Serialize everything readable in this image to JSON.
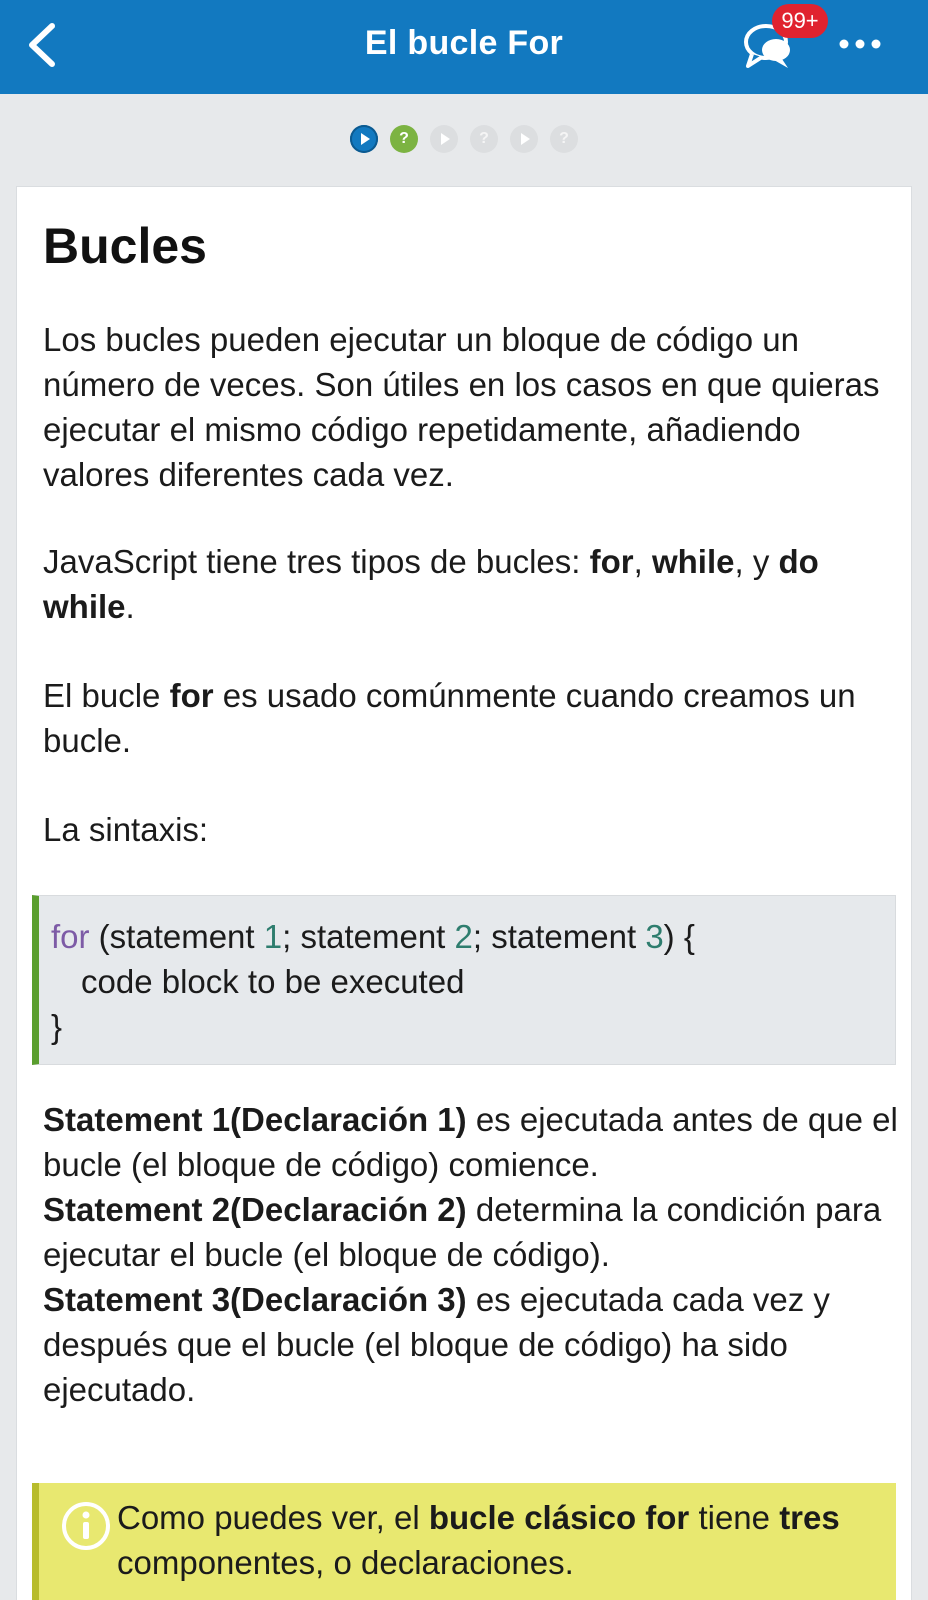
{
  "header": {
    "title": "El bucle For",
    "badge": "99+",
    "icons": {
      "back": "chevron-left-icon",
      "chat": "chat-bubbles-icon",
      "more": "more-dots-icon"
    },
    "background": "#1279c0"
  },
  "progress": {
    "steps": [
      {
        "type": "lesson",
        "state": "active",
        "glyph": ""
      },
      {
        "type": "quiz",
        "state": "done",
        "glyph": "?"
      },
      {
        "type": "lesson",
        "state": "pending",
        "glyph": ""
      },
      {
        "type": "quiz",
        "state": "pending",
        "glyph": "?"
      },
      {
        "type": "lesson",
        "state": "pending",
        "glyph": ""
      },
      {
        "type": "quiz",
        "state": "pending",
        "glyph": "?"
      }
    ]
  },
  "content": {
    "heading": "Bucles",
    "p1": "Los bucles pueden ejecutar un bloque de código un número de veces. Son útiles en los casos en que quieras ejecutar el mismo código repetidamente, añadiendo valores diferentes cada vez.",
    "p2": {
      "pre": "JavaScript tiene tres tipos de bucles: ",
      "b1": "for",
      "sep1": ", ",
      "b2": "while",
      "sep2": ", y ",
      "b3": "do while",
      "post": "."
    },
    "p3": {
      "pre": "El bucle ",
      "bold": "for",
      "post": " es usado comúnmente cuando creamos un bucle."
    },
    "p4": "La sintaxis:",
    "code": {
      "kw": "for",
      "l1a": " (statement ",
      "n1": "1",
      "l1b": "; statement ",
      "n2": "2",
      "l1c": "; statement ",
      "n3": "3",
      "l1d": ") {",
      "line2": "code block to be executed",
      "line3": "}"
    },
    "statements": [
      {
        "bold": "Statement 1(Declaración 1)",
        "text": " es ejecutada antes de que el bucle (el bloque de código) comience."
      },
      {
        "bold": "Statement 2(Declaración 2)",
        "text": " determina la condición para ejecutar el bucle (el bloque de código)."
      },
      {
        "bold": "Statement 3(Declaración 3)",
        "text": " es ejecutada cada vez y después que el bucle (el bloque de código) ha sido ejecutado."
      }
    ],
    "note": {
      "icon": "info-icon",
      "pre": "Como puedes ver, el ",
      "bold1": "bucle clásico for",
      "mid": " tiene ",
      "bold2": "tres",
      "post": " componentes, o declaraciones."
    }
  }
}
